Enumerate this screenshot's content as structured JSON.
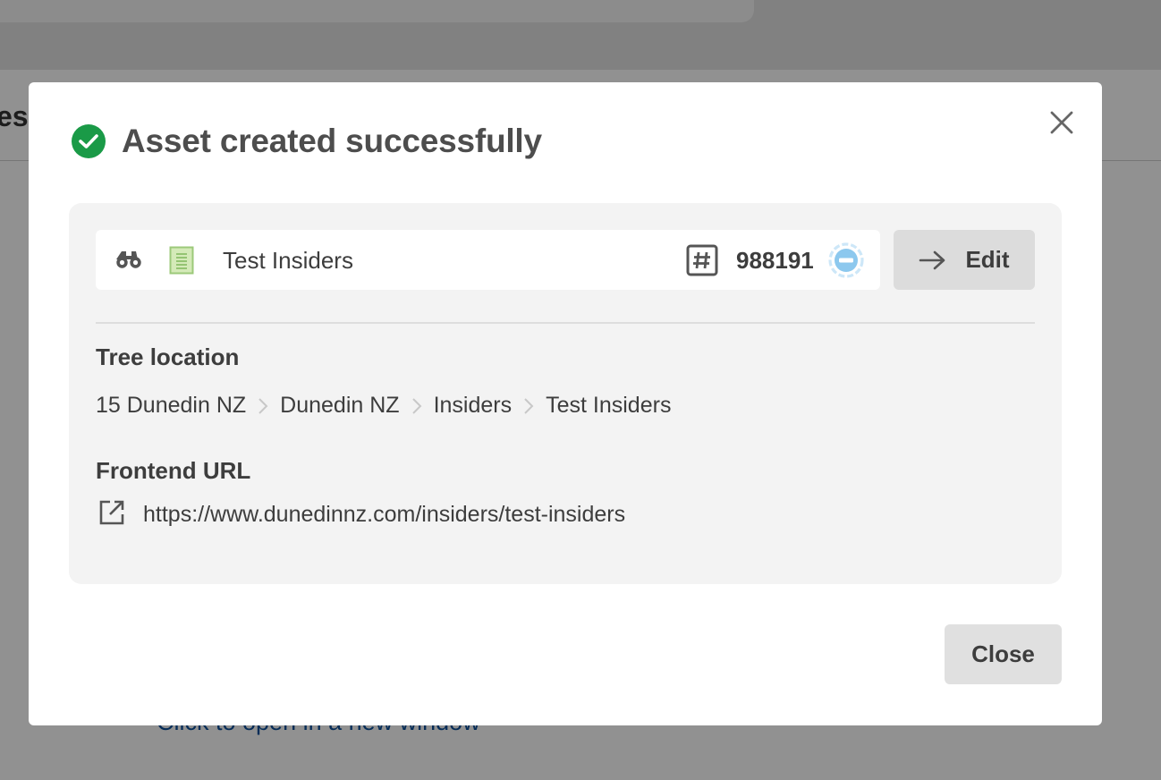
{
  "background": {
    "heading_fragment": "es",
    "link_text": "Click to open in a new window"
  },
  "modal": {
    "title": "Asset created successfully",
    "close_icon": "close-x-icon",
    "asset": {
      "name": "Test Insiders",
      "id": "988191",
      "icons": [
        "binoculars-icon",
        "standard-page-icon",
        "hash-icon",
        "status-icon"
      ]
    },
    "edit_label": "Edit",
    "tree_location": {
      "label": "Tree location",
      "items": [
        "15 Dunedin NZ",
        "Dunedin NZ",
        "Insiders",
        "Test Insiders"
      ]
    },
    "frontend_url": {
      "label": "Frontend URL",
      "url": "https://www.dunedinnz.com/insiders/test-insiders"
    },
    "close_label": "Close"
  },
  "colors": {
    "success": "#1a9a47",
    "status_blue": "#8cc8ee",
    "page_icon_green": "#b9da9a"
  }
}
